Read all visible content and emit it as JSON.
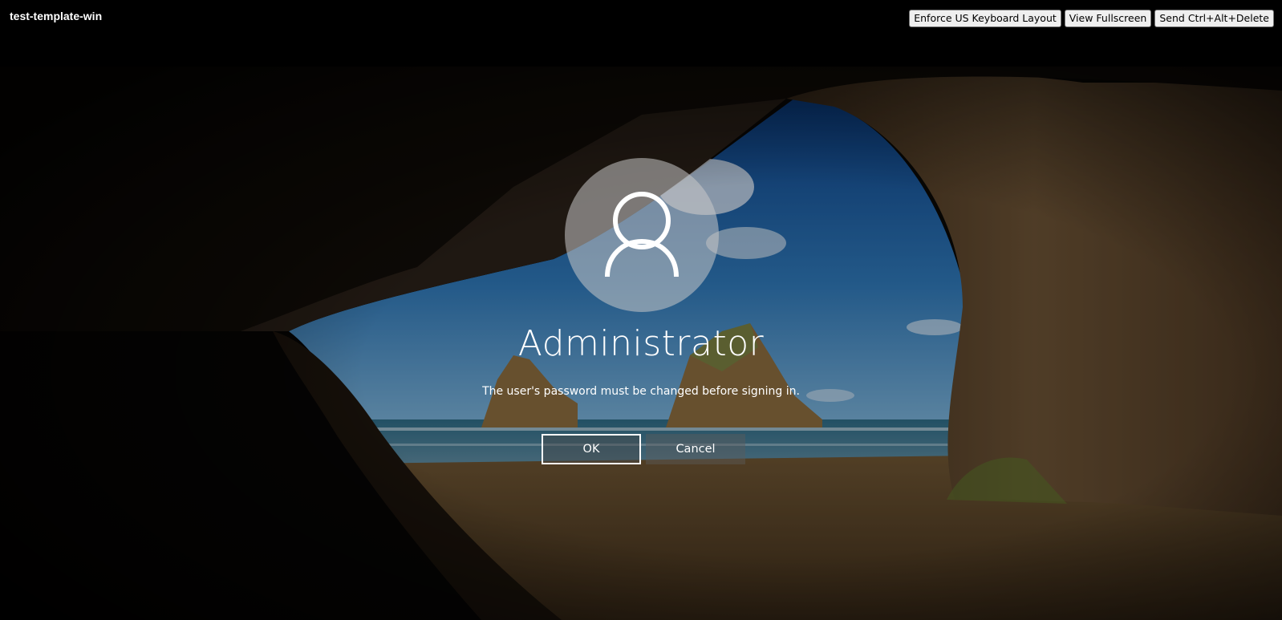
{
  "app": {
    "title": "test-template-win"
  },
  "toolbar": {
    "keyboard_label": "Enforce US Keyboard Layout",
    "fullscreen_label": "View Fullscreen",
    "cad_label": "Send Ctrl+Alt+Delete"
  },
  "login": {
    "avatar_icon": "user-icon",
    "username": "Administrator",
    "message": "The user's password must be changed before signing in.",
    "ok_label": "OK",
    "cancel_label": "Cancel"
  },
  "colors": {
    "page_background": "#000000",
    "text": "#ffffff",
    "avatar_fill": "#c8c8c8"
  }
}
